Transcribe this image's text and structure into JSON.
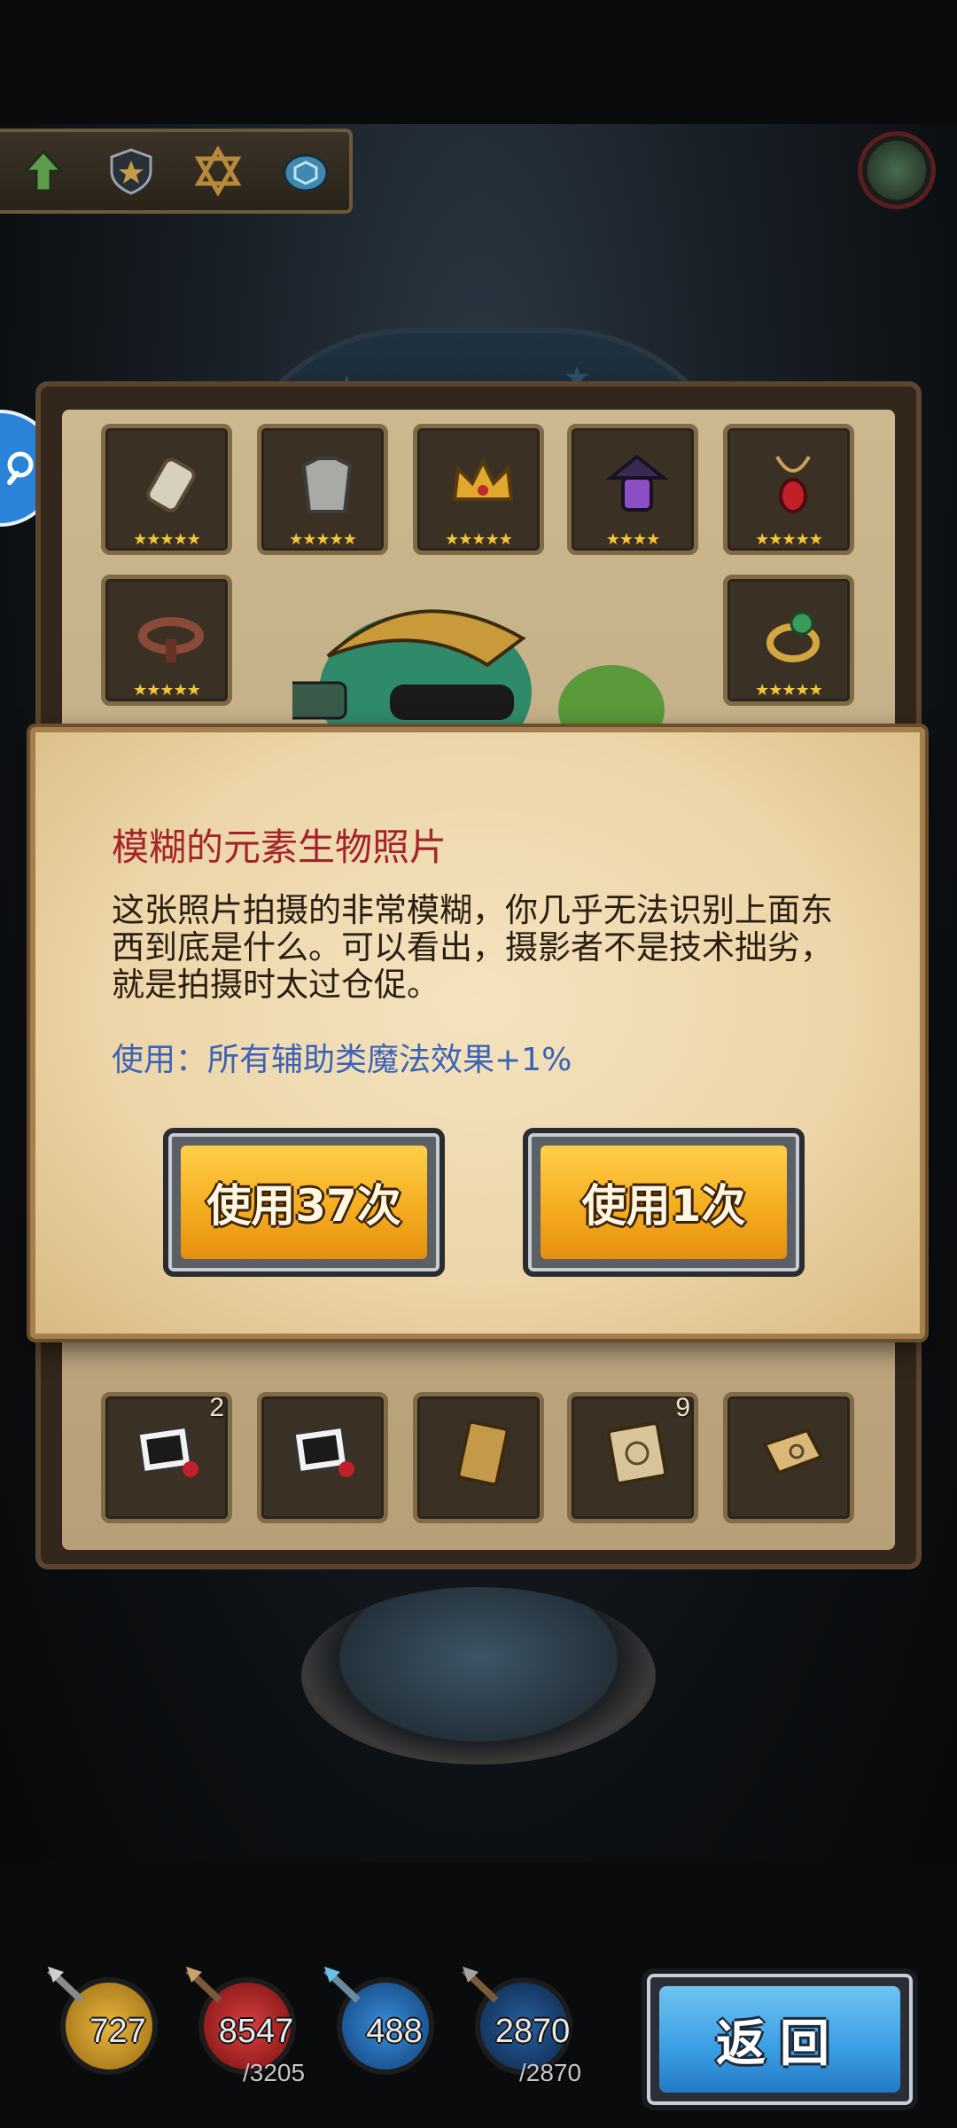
{
  "dialog": {
    "title": "模糊的元素生物照片",
    "description": "这张照片拍摄的非常模糊，你几乎无法识别上面东西到底是什么。可以看出，摄影者不是技术拙劣，就是拍摄时太过仓促。",
    "use_effect": "使用：所有辅助类魔法效果+1%",
    "use_all_label": "使用37次",
    "use_one_label": "使用1次"
  },
  "toolbar": {
    "icons": [
      "up-arrow-icon",
      "shield-star-icon",
      "hexagram-icon",
      "turtle-shell-icon"
    ]
  },
  "inventory": {
    "equipment": [
      {
        "icon": "bracer-icon",
        "stars": "★★★★★"
      },
      {
        "icon": "chainmail-armor-icon",
        "stars": "★★★★★"
      },
      {
        "icon": "crown-icon",
        "stars": "★★★★★"
      },
      {
        "icon": "lantern-icon",
        "stars": "★★★★"
      },
      {
        "icon": "ruby-amulet-icon",
        "stars": "★★★★★"
      },
      {
        "icon": "belt-icon",
        "stars": "★★★★★"
      },
      {
        "icon": "emerald-ring-icon",
        "stars": "★★★★★"
      }
    ],
    "items": [
      {
        "icon": "photo-with-rose-icon",
        "count": "2"
      },
      {
        "icon": "photo-with-rose-icon",
        "count": ""
      },
      {
        "icon": "card-icon",
        "count": ""
      },
      {
        "icon": "compass-book-icon",
        "count": "9"
      },
      {
        "icon": "scroll-map-icon",
        "count": ""
      }
    ]
  },
  "stats": [
    {
      "value": "727",
      "max": "",
      "color": "#d9a62a"
    },
    {
      "value": "8547",
      "max": "/3205",
      "color": "#c83030"
    },
    {
      "value": "488",
      "max": "",
      "color": "#2e78c8"
    },
    {
      "value": "2870",
      "max": "/2870",
      "color": "#1f4f8c"
    }
  ],
  "return_label": "返回"
}
